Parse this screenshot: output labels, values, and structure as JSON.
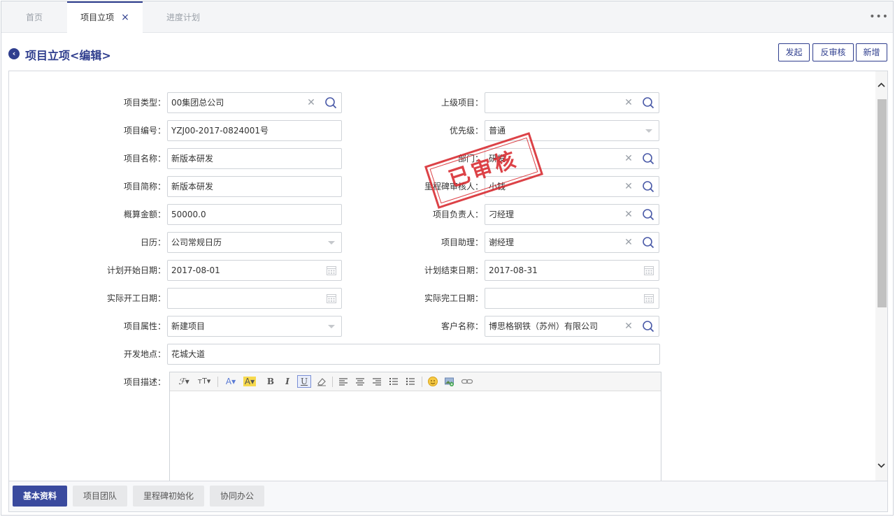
{
  "tabs": [
    {
      "label": "首页"
    },
    {
      "label": "项目立项"
    },
    {
      "label": "进度计划"
    }
  ],
  "tab_close": "×",
  "more": "•••",
  "header": {
    "title": "项目立项<编辑>",
    "back": "‹",
    "buttons": {
      "start": "发起",
      "unaudit": "反审核",
      "add": "新增"
    }
  },
  "stamp": "已审核",
  "form": {
    "project_type": {
      "label": "项目类型：",
      "value": "00集团总公司"
    },
    "parent_project": {
      "label": "上级项目：",
      "value": ""
    },
    "project_code": {
      "label": "项目编号：",
      "value": "YZJ00-2017-0824001号"
    },
    "priority": {
      "label": "优先级：",
      "value": "普通"
    },
    "project_name": {
      "label": "项目名称：",
      "value": "新版本研发"
    },
    "department": {
      "label": "部门：",
      "value": "研发"
    },
    "project_short": {
      "label": "项目简称：",
      "value": "新版本研发"
    },
    "milestone_owner": {
      "label": "里程碑审核人：",
      "value": "小钱"
    },
    "budget": {
      "label": "概算金额：",
      "value": "50000.0"
    },
    "manager": {
      "label": "项目负责人：",
      "value": "刁经理"
    },
    "calendar": {
      "label": "日历：",
      "value": "公司常规日历"
    },
    "assistant": {
      "label": "项目助理：",
      "value": "谢经理"
    },
    "plan_start": {
      "label": "计划开始日期：",
      "value": "2017-08-01"
    },
    "plan_end": {
      "label": "计划结束日期：",
      "value": "2017-08-31"
    },
    "actual_start": {
      "label": "实际开工日期：",
      "value": ""
    },
    "actual_end": {
      "label": "实际完工日期：",
      "value": ""
    },
    "attribute": {
      "label": "项目属性：",
      "value": "新建项目"
    },
    "customer": {
      "label": "客户名称：",
      "value": "博思格钢铁（苏州）有限公司"
    },
    "location": {
      "label": "开发地点：",
      "value": "花城大道"
    },
    "description": {
      "label": "项目描述：",
      "value": ""
    }
  },
  "editor_tools": {
    "font": "ℱ▾",
    "size": "тT▾",
    "color": "A▾",
    "bg": "A▾",
    "bold": "B",
    "italic": "I",
    "underline": "U"
  },
  "bottom_tabs": [
    {
      "label": "基本资料"
    },
    {
      "label": "项目团队"
    },
    {
      "label": "里程碑初始化"
    },
    {
      "label": "协同办公"
    }
  ],
  "colors": {
    "accent": "#2f3e8e",
    "stamp": "#d8282e"
  }
}
